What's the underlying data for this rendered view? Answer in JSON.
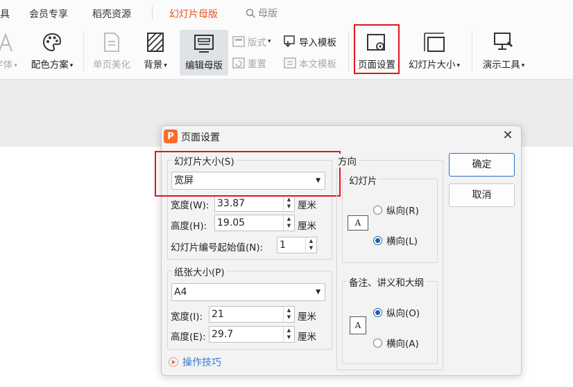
{
  "menubar": {
    "items": [
      "具",
      "会员专享",
      "稻壳资源",
      "幻灯片母版"
    ],
    "active": "幻灯片母版",
    "search_label": "母版"
  },
  "toolbar": {
    "font": "字体",
    "color_scheme": "配色方案",
    "single_page_beautify": "单页美化",
    "background": "背景",
    "edit_master": "编辑母版",
    "layout": "版式",
    "import_template": "导入模板",
    "rename": "重置",
    "text_template": "本文模板",
    "page_setup": "页面设置",
    "slide_size": "幻灯片大小",
    "presenter_tools": "演示工具"
  },
  "dialog": {
    "title": "页面设置",
    "slide_size_group": "幻灯片大小(S)",
    "slide_size_value": "宽屏",
    "width_label": "宽度(W):",
    "width_value": "33.87",
    "height_label": "高度(H):",
    "height_value": "19.05",
    "unit": "厘米",
    "slide_number_label": "幻灯片编号起始值(N):",
    "slide_number_value": "1",
    "paper_group": "纸张大小(P)",
    "paper_value": "A4",
    "paper_width_label": "宽度(I):",
    "paper_width_value": "21",
    "paper_height_label": "高度(E):",
    "paper_height_value": "29.7",
    "orientation_group": "方向",
    "slides_group": "幻灯片",
    "portrait_r": "纵向(R)",
    "landscape_l": "横向(L)",
    "notes_group": "备注、讲义和大纲",
    "portrait_o": "纵向(O)",
    "landscape_a": "横向(A)",
    "ok": "确定",
    "cancel": "取消",
    "tips": "操作技巧",
    "icon_letter": "A"
  },
  "colors": {
    "accent": "#e8531f",
    "highlight_box": "#e0141e",
    "link": "#2f7ad7",
    "radio": "#1e5fae"
  }
}
